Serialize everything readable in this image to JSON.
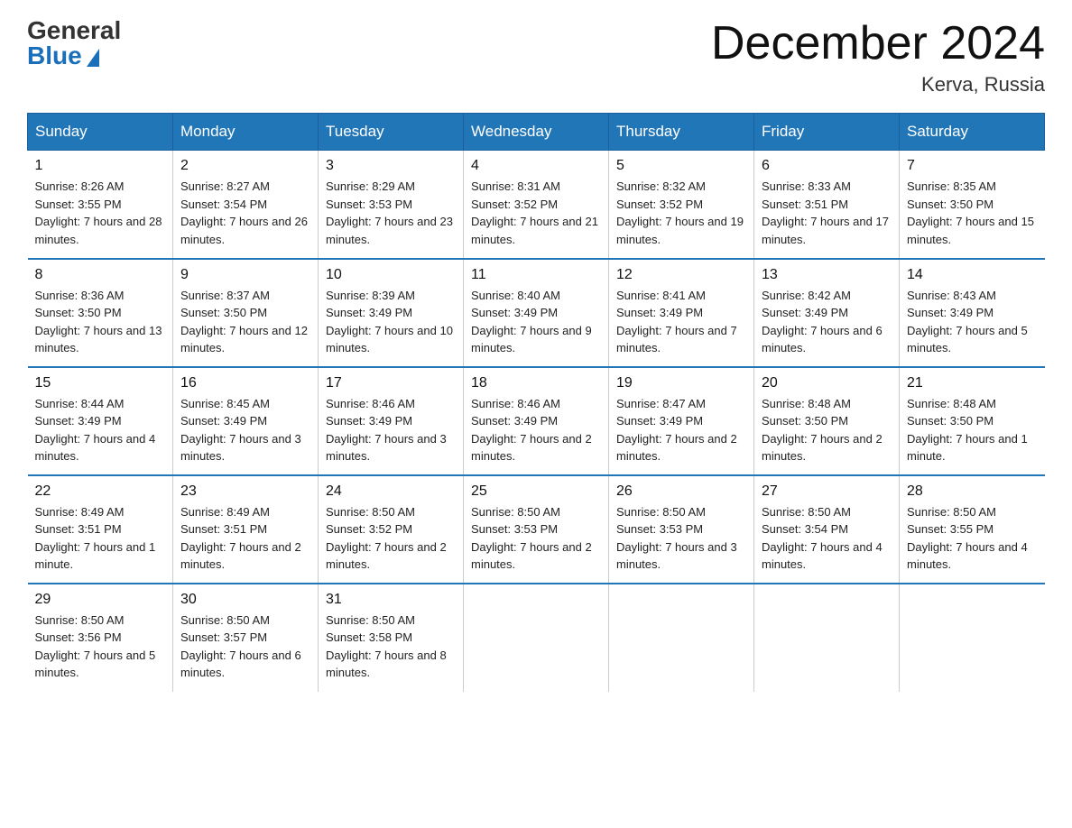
{
  "header": {
    "logo_general": "General",
    "logo_blue": "Blue",
    "month_title": "December 2024",
    "location": "Kerva, Russia"
  },
  "days_of_week": [
    "Sunday",
    "Monday",
    "Tuesday",
    "Wednesday",
    "Thursday",
    "Friday",
    "Saturday"
  ],
  "weeks": [
    [
      {
        "num": "1",
        "sunrise": "8:26 AM",
        "sunset": "3:55 PM",
        "daylight": "7 hours and 28 minutes."
      },
      {
        "num": "2",
        "sunrise": "8:27 AM",
        "sunset": "3:54 PM",
        "daylight": "7 hours and 26 minutes."
      },
      {
        "num": "3",
        "sunrise": "8:29 AM",
        "sunset": "3:53 PM",
        "daylight": "7 hours and 23 minutes."
      },
      {
        "num": "4",
        "sunrise": "8:31 AM",
        "sunset": "3:52 PM",
        "daylight": "7 hours and 21 minutes."
      },
      {
        "num": "5",
        "sunrise": "8:32 AM",
        "sunset": "3:52 PM",
        "daylight": "7 hours and 19 minutes."
      },
      {
        "num": "6",
        "sunrise": "8:33 AM",
        "sunset": "3:51 PM",
        "daylight": "7 hours and 17 minutes."
      },
      {
        "num": "7",
        "sunrise": "8:35 AM",
        "sunset": "3:50 PM",
        "daylight": "7 hours and 15 minutes."
      }
    ],
    [
      {
        "num": "8",
        "sunrise": "8:36 AM",
        "sunset": "3:50 PM",
        "daylight": "7 hours and 13 minutes."
      },
      {
        "num": "9",
        "sunrise": "8:37 AM",
        "sunset": "3:50 PM",
        "daylight": "7 hours and 12 minutes."
      },
      {
        "num": "10",
        "sunrise": "8:39 AM",
        "sunset": "3:49 PM",
        "daylight": "7 hours and 10 minutes."
      },
      {
        "num": "11",
        "sunrise": "8:40 AM",
        "sunset": "3:49 PM",
        "daylight": "7 hours and 9 minutes."
      },
      {
        "num": "12",
        "sunrise": "8:41 AM",
        "sunset": "3:49 PM",
        "daylight": "7 hours and 7 minutes."
      },
      {
        "num": "13",
        "sunrise": "8:42 AM",
        "sunset": "3:49 PM",
        "daylight": "7 hours and 6 minutes."
      },
      {
        "num": "14",
        "sunrise": "8:43 AM",
        "sunset": "3:49 PM",
        "daylight": "7 hours and 5 minutes."
      }
    ],
    [
      {
        "num": "15",
        "sunrise": "8:44 AM",
        "sunset": "3:49 PM",
        "daylight": "7 hours and 4 minutes."
      },
      {
        "num": "16",
        "sunrise": "8:45 AM",
        "sunset": "3:49 PM",
        "daylight": "7 hours and 3 minutes."
      },
      {
        "num": "17",
        "sunrise": "8:46 AM",
        "sunset": "3:49 PM",
        "daylight": "7 hours and 3 minutes."
      },
      {
        "num": "18",
        "sunrise": "8:46 AM",
        "sunset": "3:49 PM",
        "daylight": "7 hours and 2 minutes."
      },
      {
        "num": "19",
        "sunrise": "8:47 AM",
        "sunset": "3:49 PM",
        "daylight": "7 hours and 2 minutes."
      },
      {
        "num": "20",
        "sunrise": "8:48 AM",
        "sunset": "3:50 PM",
        "daylight": "7 hours and 2 minutes."
      },
      {
        "num": "21",
        "sunrise": "8:48 AM",
        "sunset": "3:50 PM",
        "daylight": "7 hours and 1 minute."
      }
    ],
    [
      {
        "num": "22",
        "sunrise": "8:49 AM",
        "sunset": "3:51 PM",
        "daylight": "7 hours and 1 minute."
      },
      {
        "num": "23",
        "sunrise": "8:49 AM",
        "sunset": "3:51 PM",
        "daylight": "7 hours and 2 minutes."
      },
      {
        "num": "24",
        "sunrise": "8:50 AM",
        "sunset": "3:52 PM",
        "daylight": "7 hours and 2 minutes."
      },
      {
        "num": "25",
        "sunrise": "8:50 AM",
        "sunset": "3:53 PM",
        "daylight": "7 hours and 2 minutes."
      },
      {
        "num": "26",
        "sunrise": "8:50 AM",
        "sunset": "3:53 PM",
        "daylight": "7 hours and 3 minutes."
      },
      {
        "num": "27",
        "sunrise": "8:50 AM",
        "sunset": "3:54 PM",
        "daylight": "7 hours and 4 minutes."
      },
      {
        "num": "28",
        "sunrise": "8:50 AM",
        "sunset": "3:55 PM",
        "daylight": "7 hours and 4 minutes."
      }
    ],
    [
      {
        "num": "29",
        "sunrise": "8:50 AM",
        "sunset": "3:56 PM",
        "daylight": "7 hours and 5 minutes."
      },
      {
        "num": "30",
        "sunrise": "8:50 AM",
        "sunset": "3:57 PM",
        "daylight": "7 hours and 6 minutes."
      },
      {
        "num": "31",
        "sunrise": "8:50 AM",
        "sunset": "3:58 PM",
        "daylight": "7 hours and 8 minutes."
      },
      null,
      null,
      null,
      null
    ]
  ]
}
